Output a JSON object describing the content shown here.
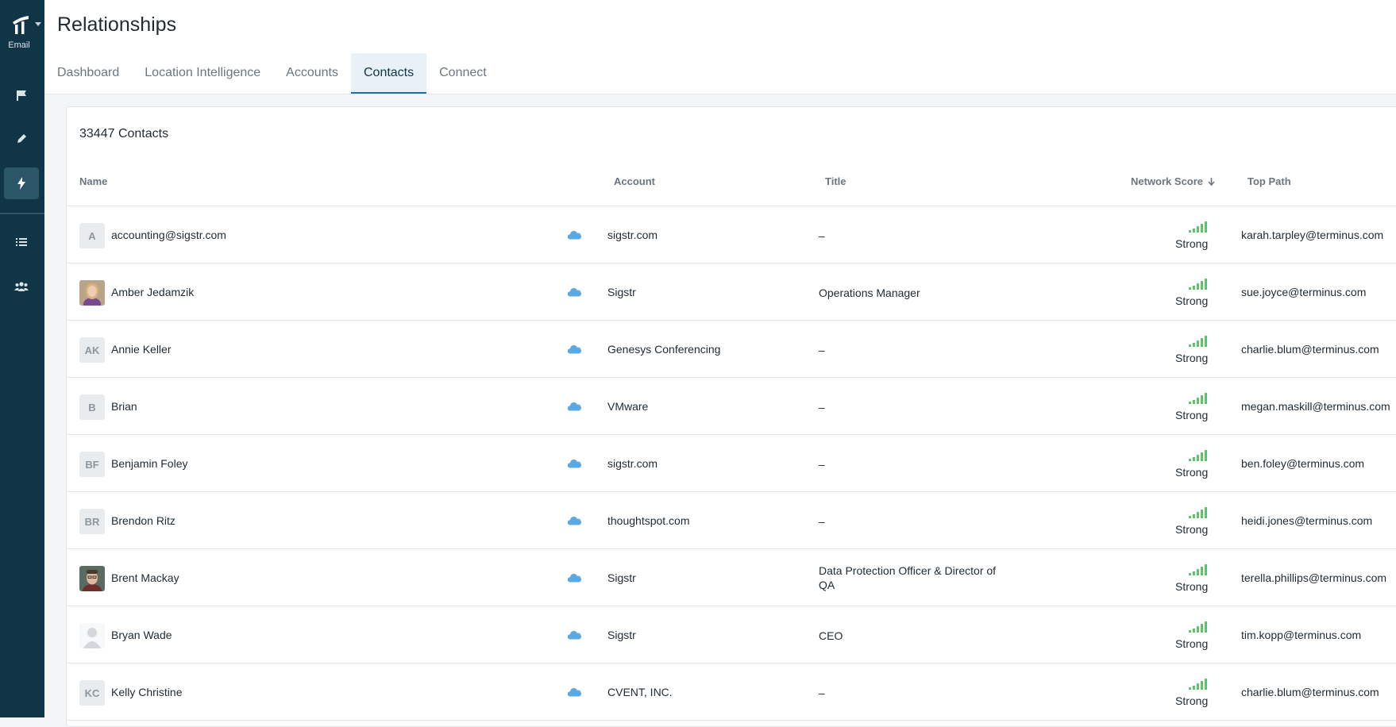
{
  "sidebar": {
    "brand_label": "Email",
    "icons": [
      "flag-icon",
      "pen-icon",
      "bolt-icon",
      "list-icon",
      "people-icon"
    ]
  },
  "header": {
    "title": "Relationships",
    "tabs": [
      {
        "label": "Dashboard"
      },
      {
        "label": "Location Intelligence"
      },
      {
        "label": "Accounts"
      },
      {
        "label": "Contacts",
        "active": true
      },
      {
        "label": "Connect"
      }
    ]
  },
  "contacts": {
    "count_label": "33447 Contacts",
    "columns": {
      "name": "Name",
      "account": "Account",
      "title": "Title",
      "network_score": "Network Score",
      "top_path": "Top Path"
    },
    "rows": [
      {
        "initials": "A",
        "name": "accounting@sigstr.com",
        "account": "sigstr.com",
        "title": "–",
        "score": "Strong",
        "top_path": "karah.tarpley@terminus.com"
      },
      {
        "initials": "",
        "avatar": "photo-female",
        "name": "Amber Jedamzik",
        "account": "Sigstr",
        "title": "Operations Manager",
        "score": "Strong",
        "top_path": "sue.joyce@terminus.com"
      },
      {
        "initials": "AK",
        "name": "Annie Keller",
        "account": "Genesys Conferencing",
        "title": "–",
        "score": "Strong",
        "top_path": "charlie.blum@terminus.com"
      },
      {
        "initials": "B",
        "name": "Brian",
        "account": "VMware",
        "title": "–",
        "score": "Strong",
        "top_path": "megan.maskill@terminus.com"
      },
      {
        "initials": "BF",
        "name": "Benjamin Foley",
        "account": "sigstr.com",
        "title": "–",
        "score": "Strong",
        "top_path": "ben.foley@terminus.com"
      },
      {
        "initials": "BR",
        "name": "Brendon Ritz",
        "account": "thoughtspot.com",
        "title": "–",
        "score": "Strong",
        "top_path": "heidi.jones@terminus.com"
      },
      {
        "initials": "",
        "avatar": "photo-male",
        "name": "Brent Mackay",
        "account": "Sigstr",
        "title": "Data Protection Officer & Director of QA",
        "score": "Strong",
        "top_path": "terella.phillips@terminus.com"
      },
      {
        "initials": "",
        "avatar": "silhouette",
        "name": "Bryan Wade",
        "account": "Sigstr",
        "title": "CEO",
        "score": "Strong",
        "top_path": "tim.kopp@terminus.com"
      },
      {
        "initials": "KC",
        "name": "Kelly Christine",
        "account": "CVENT, INC.",
        "title": "–",
        "score": "Strong",
        "top_path": "charlie.blum@terminus.com"
      }
    ]
  },
  "colors": {
    "sidebar": "#0f3547",
    "accent": "#1f6fa8",
    "strong": "#5cc36b",
    "cloud": "#5aa9e6"
  }
}
